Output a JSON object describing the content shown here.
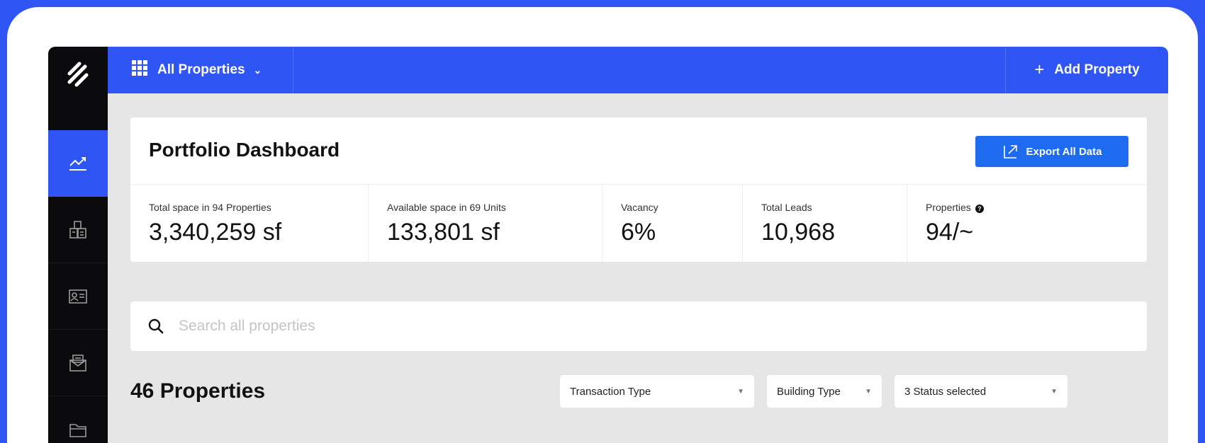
{
  "topbar": {
    "all_properties_label": "All Properties",
    "add_property_label": "Add Property"
  },
  "sidebar": {
    "items": [
      {
        "icon": "analytics-icon",
        "active": true
      },
      {
        "icon": "buildings-icon",
        "active": false
      },
      {
        "icon": "contact-card-icon",
        "active": false
      },
      {
        "icon": "mail-icon",
        "active": false
      },
      {
        "icon": "folder-icon",
        "active": false
      }
    ]
  },
  "dashboard": {
    "title": "Portfolio Dashboard",
    "export_label": "Export All Data",
    "stats": [
      {
        "label": "Total space in 94 Properties",
        "value": "3,340,259 sf"
      },
      {
        "label": "Available space in 69 Units",
        "value": "133,801 sf"
      },
      {
        "label": "Vacancy",
        "value": "6%"
      },
      {
        "label": "Total Leads",
        "value": "10,968"
      },
      {
        "label": "Properties",
        "value": "94/~",
        "info_icon": "?"
      }
    ]
  },
  "search": {
    "placeholder": "Search all properties",
    "value": ""
  },
  "listing": {
    "count_label": "46 Properties",
    "filters": [
      {
        "label": "Transaction Type"
      },
      {
        "label": "Building Type"
      },
      {
        "label": "3 Status selected"
      }
    ]
  },
  "colors": {
    "brand_blue": "#2f55f5",
    "button_blue": "#1e6bf0",
    "sidebar_bg": "#0b0b0d",
    "content_bg": "#e6e6e6"
  }
}
